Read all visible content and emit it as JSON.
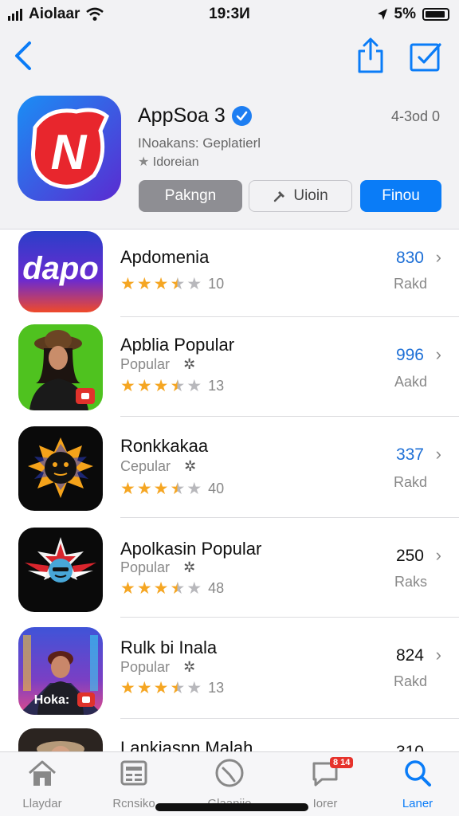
{
  "status_bar": {
    "carrier": "Aiolaar",
    "time": "19:3И",
    "battery": "5%"
  },
  "hero": {
    "title": "AppSoa 3",
    "rank": "4-3od 0",
    "subtitle": "INoakans: Geplatierl",
    "category": "Idoreian",
    "btn_secondary": "Pakngn",
    "btn_outline": "Uioin",
    "btn_primary": "Finou"
  },
  "apps": [
    {
      "name": "Apdomenia",
      "category": "",
      "rating_count": "10",
      "score": "830",
      "label": "Rakd",
      "score_color": "#1d6fd6",
      "icon": "dapo-logo-icon"
    },
    {
      "name": "Apblia Popular",
      "category": "Popular",
      "rating_count": "13",
      "score": "996",
      "label": "Aakd",
      "score_color": "#1d6fd6",
      "icon": "portrait-woman-icon"
    },
    {
      "name": "Ronkkakaa",
      "category": "Cepular",
      "rating_count": "40",
      "score": "337",
      "label": "Rakd",
      "score_color": "#1d6fd6",
      "icon": "sun-face-icon"
    },
    {
      "name": "Apolkasin Popular",
      "category": "Popular",
      "rating_count": "48",
      "score": "250",
      "label": "Raks",
      "score_color": "#111111",
      "icon": "winged-emblem-icon"
    },
    {
      "name": "Rulk bi Inala",
      "category": "Popular",
      "rating_count": "13",
      "score": "824",
      "label": "Rakd",
      "score_color": "#111111",
      "icon": "street-portrait-icon"
    },
    {
      "name": "Lankiaspn Malah",
      "category": "",
      "rating_count": "",
      "score": "310",
      "label": "",
      "score_color": "#1d6fd6",
      "icon": "hat-portrait-icon"
    }
  ],
  "rating_stars": 3.5,
  "tabs": [
    {
      "label": "Llaydar",
      "icon": "home-icon"
    },
    {
      "label": "Rcnsiko",
      "icon": "news-icon"
    },
    {
      "label": "Glaaniio",
      "icon": "rocket-icon"
    },
    {
      "label": "Iorer",
      "icon": "chat-icon",
      "badge": "8 14"
    },
    {
      "label": "Laner",
      "icon": "search-icon"
    }
  ],
  "colors": {
    "accent": "#0a7cf7",
    "star": "#f5a623",
    "star_empty": "#b8b8bc"
  }
}
